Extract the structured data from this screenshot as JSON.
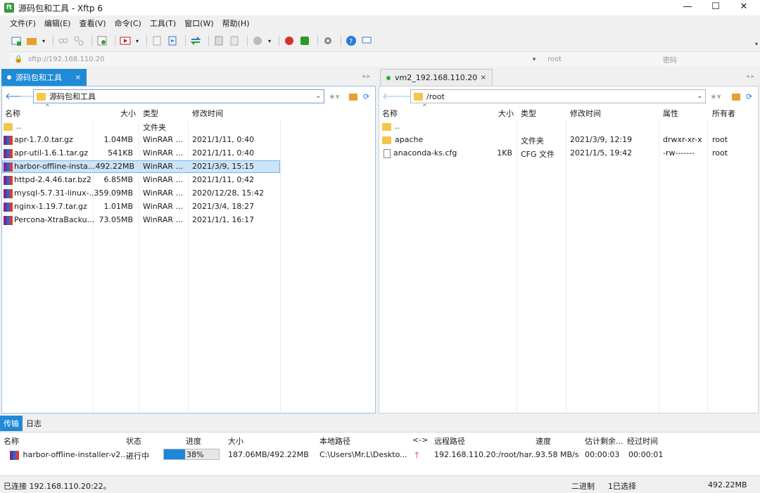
{
  "window": {
    "title": "源码包和工具 - Xftp 6",
    "minimize": "—",
    "maximize": "☐",
    "close": "✕"
  },
  "menu": [
    "文件(F)",
    "编辑(E)",
    "查看(V)",
    "命令(C)",
    "工具(T)",
    "窗口(W)",
    "帮助(H)"
  ],
  "address": {
    "placeholder": "sftp://192.168.110.20",
    "user_placeholder": "root",
    "password_placeholder": "密码"
  },
  "left": {
    "tab": "源码包和工具",
    "path": "源码包和工具",
    "columns": [
      "名称",
      "大小",
      "类型",
      "修改时间"
    ],
    "rows": [
      {
        "name": "..",
        "size": "",
        "type": "文件夹",
        "modified": ""
      },
      {
        "name": "apr-1.7.0.tar.gz",
        "size": "1.04MB",
        "type": "WinRAR ...",
        "modified": "2021/1/11, 0:40"
      },
      {
        "name": "apr-util-1.6.1.tar.gz",
        "size": "541KB",
        "type": "WinRAR ...",
        "modified": "2021/1/11, 0:40"
      },
      {
        "name": "harbor-offline-insta...",
        "size": "492.22MB",
        "type": "WinRAR ...",
        "modified": "2021/3/9, 15:15"
      },
      {
        "name": "httpd-2.4.46.tar.bz2",
        "size": "6.85MB",
        "type": "WinRAR ...",
        "modified": "2021/1/11, 0:42"
      },
      {
        "name": "mysql-5.7.31-linux-...",
        "size": "359.09MB",
        "type": "WinRAR ...",
        "modified": "2020/12/28, 15:42"
      },
      {
        "name": "nginx-1.19.7.tar.gz",
        "size": "1.01MB",
        "type": "WinRAR ...",
        "modified": "2021/3/4, 18:27"
      },
      {
        "name": "Percona-XtraBacku...",
        "size": "73.05MB",
        "type": "WinRAR ...",
        "modified": "2021/1/1, 16:17"
      }
    ]
  },
  "right": {
    "tab": "vm2_192.168.110.20",
    "path": "/root",
    "columns": [
      "名称",
      "大小",
      "类型",
      "修改时间",
      "属性",
      "所有者"
    ],
    "rows": [
      {
        "name": "..",
        "size": "",
        "type": "",
        "modified": "",
        "attr": "",
        "owner": ""
      },
      {
        "name": "apache",
        "size": "",
        "type": "文件夹",
        "modified": "2021/3/9, 12:19",
        "attr": "drwxr-xr-x",
        "owner": "root"
      },
      {
        "name": "anaconda-ks.cfg",
        "size": "1KB",
        "type": "CFG 文件",
        "modified": "2021/1/5, 19:42",
        "attr": "-rw-------",
        "owner": "root"
      }
    ]
  },
  "bottom_tabs": [
    "传输",
    "日志"
  ],
  "transfer": {
    "columns": [
      "名称",
      "状态",
      "进度",
      "大小",
      "本地路径",
      "<->",
      "远程路径",
      "速度",
      "估计剩余...",
      "经过时间"
    ],
    "row": {
      "name": "harbor-offline-installer-v2....",
      "status": "进行中",
      "progress_label": "38%",
      "progress": 0.38,
      "size": "187.06MB/492.22MB",
      "local": "C:\\Users\\Mr.L\\Deskto...",
      "remote": "192.168.110.20:/root/har...",
      "speed": "93.58 MB/s",
      "remaining": "00:00:03",
      "elapsed": "00:00:01"
    }
  },
  "status": {
    "connection": "已连接 192.168.110.20:22。",
    "mode": "二进制",
    "selection": "1已选择",
    "size": "492.22MB"
  },
  "colors": {
    "accent": "#1f8ad6",
    "selection": "#cce4f7",
    "folder": "#f4c64a",
    "progress": "#1c86d8"
  }
}
